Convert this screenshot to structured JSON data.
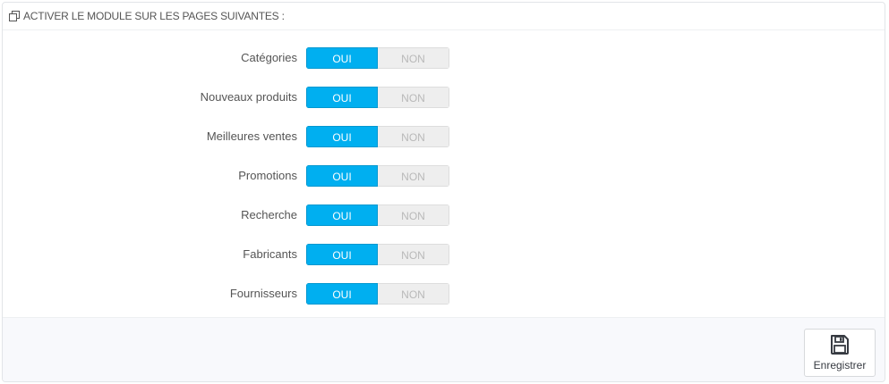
{
  "panel": {
    "title": "ACTIVER LE MODULE SUR LES PAGES SUIVANTES :",
    "title_icon": "copy-icon"
  },
  "switches": {
    "on_label": "OUI",
    "off_label": "NON",
    "items": [
      {
        "label": "Catégories",
        "value": "OUI"
      },
      {
        "label": "Nouveaux produits",
        "value": "OUI"
      },
      {
        "label": "Meilleures ventes",
        "value": "OUI"
      },
      {
        "label": "Promotions",
        "value": "OUI"
      },
      {
        "label": "Recherche",
        "value": "OUI"
      },
      {
        "label": "Fabricants",
        "value": "OUI"
      },
      {
        "label": "Fournisseurs",
        "value": "OUI"
      }
    ]
  },
  "footer": {
    "save_label": "Enregistrer",
    "save_icon": "floppy-disk-icon"
  },
  "colors": {
    "accent": "#00aff0",
    "off_bg": "#eeeeee",
    "off_text": "#b9b9b9"
  }
}
